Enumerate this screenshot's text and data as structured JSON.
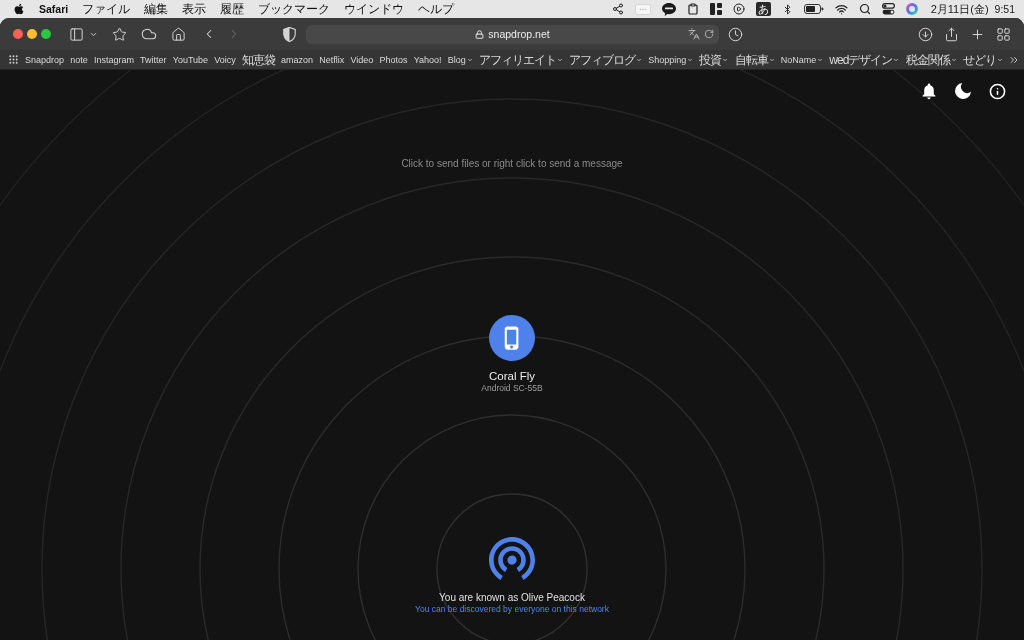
{
  "menu_bar": {
    "app_name": "Safari",
    "menus": [
      "ファイル",
      "編集",
      "表示",
      "履歴",
      "ブックマーク",
      "ウインドウ",
      "ヘルプ"
    ],
    "input_mode": "あ",
    "date": "2月11日(金)",
    "time": "9:51"
  },
  "toolbar": {
    "back_disabled": false,
    "forward_disabled": true,
    "address": "snapdrop.net"
  },
  "bookmarks": [
    {
      "label": "Snapdrop",
      "kind": "link"
    },
    {
      "label": "note",
      "kind": "link"
    },
    {
      "label": "Instagram",
      "kind": "link"
    },
    {
      "label": "Twitter",
      "kind": "link"
    },
    {
      "label": "YouTube",
      "kind": "link"
    },
    {
      "label": "Voicy",
      "kind": "link"
    },
    {
      "label": "知恵袋",
      "kind": "link"
    },
    {
      "label": "amazon",
      "kind": "link"
    },
    {
      "label": "Netflix",
      "kind": "link"
    },
    {
      "label": "Video",
      "kind": "link"
    },
    {
      "label": "Photos",
      "kind": "link"
    },
    {
      "label": "Yahoo!",
      "kind": "link"
    },
    {
      "label": "Blog",
      "kind": "folder"
    },
    {
      "label": "アフィリエイト",
      "kind": "folder"
    },
    {
      "label": "アフィブログ",
      "kind": "folder"
    },
    {
      "label": "Shopping",
      "kind": "folder"
    },
    {
      "label": "投資",
      "kind": "folder"
    },
    {
      "label": "自転車",
      "kind": "folder"
    },
    {
      "label": "NoName",
      "kind": "folder"
    },
    {
      "label": "wedデザイン",
      "kind": "folder"
    },
    {
      "label": "税金関係",
      "kind": "folder"
    },
    {
      "label": "せどり",
      "kind": "folder"
    }
  ],
  "page": {
    "hint": "Click to send files or right click to send a message",
    "peers": [
      {
        "name": "Coral Fly",
        "device": "Android SC-55B",
        "kind": "phone"
      }
    ],
    "self": {
      "title": "You are known as Olive Peacock",
      "discovery": "You can be discovered by everyone on this network"
    }
  }
}
